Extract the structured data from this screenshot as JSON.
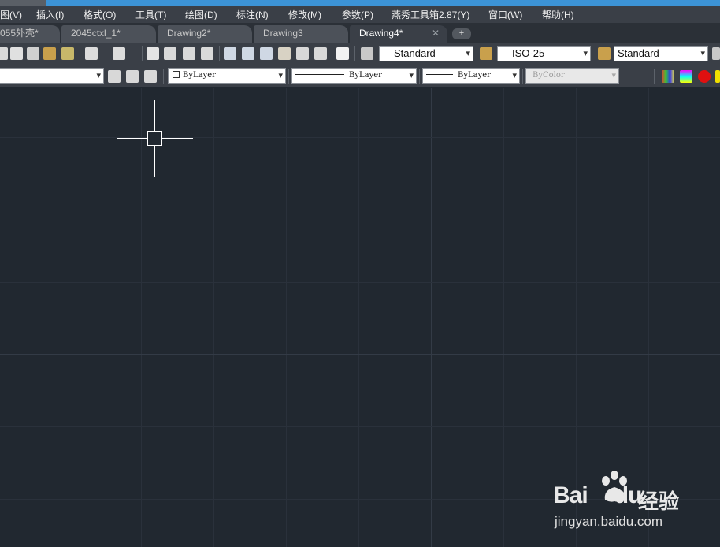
{
  "menus": [
    {
      "label": "图(V)"
    },
    {
      "label": "插入(I)"
    },
    {
      "label": "格式(O)"
    },
    {
      "label": "工具(T)"
    },
    {
      "label": "绘图(D)"
    },
    {
      "label": "标注(N)"
    },
    {
      "label": "修改(M)"
    },
    {
      "label": "参数(P)"
    },
    {
      "label": "燕秀工具箱2.87(Y)"
    },
    {
      "label": "窗口(W)"
    },
    {
      "label": "帮助(H)"
    }
  ],
  "tabs": [
    {
      "label": "055外壳*"
    },
    {
      "label": "2045ctxl_1*"
    },
    {
      "label": "Drawing2*"
    },
    {
      "label": "Drawing3"
    },
    {
      "label": "Drawing4*",
      "active": true,
      "close": "✕"
    }
  ],
  "new_tab": "+",
  "toolbar": {
    "text_style": "Standard",
    "dim_style": "ISO-25",
    "table_style": "Standard",
    "color": "ByLayer",
    "linetype": "ByLayer",
    "lineweight": "ByLayer",
    "plot_style": "ByColor"
  },
  "watermark": {
    "logo_left": "Bai",
    "logo_right": "du",
    "brand": "经验",
    "url": "jingyan.baidu.com"
  },
  "colors": {
    "canvas": "#212830",
    "accent": "#3c93d6"
  }
}
